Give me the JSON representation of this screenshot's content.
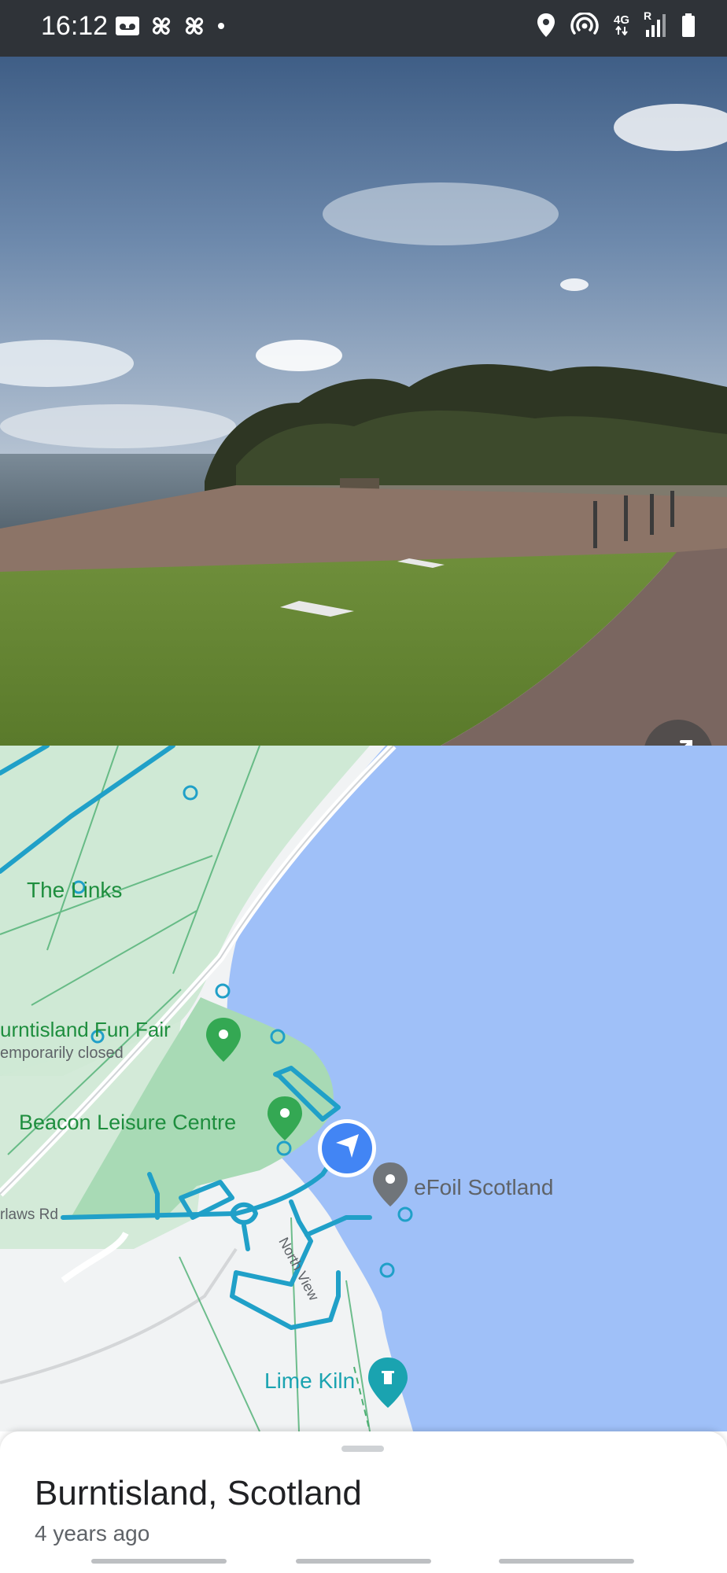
{
  "status_bar": {
    "time": "16:12",
    "network_type": "4G",
    "roaming": "R",
    "left_icons": [
      "voicemail-icon",
      "fan-icon",
      "fan-icon",
      "dot-icon"
    ],
    "right_icons": [
      "location-icon",
      "hotspot-icon",
      "signal-icon",
      "battery-icon"
    ]
  },
  "street_view": {
    "expand_icon": "expand-icon"
  },
  "map": {
    "labels": {
      "links": "The Links",
      "funfair": "urntisland Fun Fair",
      "funfair_status": "emporarily closed",
      "leisure": "Beacon Leisure Centre",
      "efoil": "eFoil Scotland",
      "road": "rlaws Rd",
      "north_view": "North View",
      "lime_kiln": "Lime Kiln"
    },
    "colors": {
      "water": "#9fc0f8",
      "park": "#cfe9d5",
      "park_dark": "#a8dab5",
      "route": "#20a0c8",
      "pin_green": "#34a853",
      "pin_gray": "#70757a",
      "location_blue": "#4285f4",
      "landmark_teal": "#1aa3b0"
    }
  },
  "sheet": {
    "title": "Burntisland, Scotland",
    "subtitle": "4 years ago"
  }
}
